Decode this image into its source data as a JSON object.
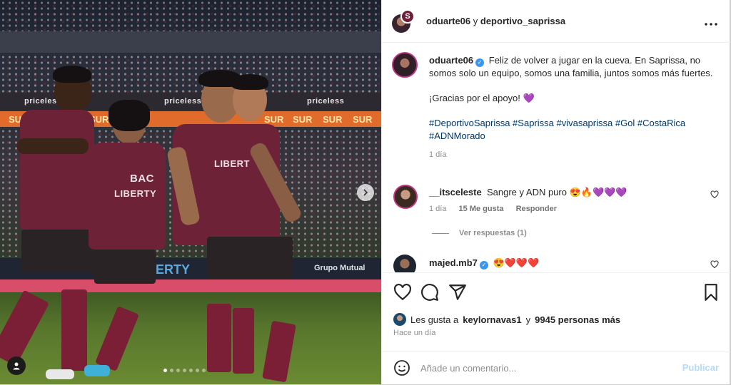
{
  "post": {
    "header": {
      "author": "oduarte06",
      "separator": "y",
      "collaborator": "deportivo_saprissa",
      "badge_letter": "S",
      "more_icon": "more-horizontal-icon"
    },
    "photo": {
      "sponsors": [
        "priceless",
        "priceless",
        "priceless",
        "SUR",
        "SUR",
        "SUR",
        "SUR",
        "SUR",
        "SUR"
      ],
      "board_texts": [
        "BERTY",
        "Grupo Mutual"
      ],
      "jersey_texts": [
        "BAC",
        "LIBERTY",
        "LIBERT"
      ],
      "carousel_count": 7,
      "carousel_active": 0
    },
    "caption": {
      "username": "oduarte06",
      "text_line1": "Feliz de volver a jugar en la cueva. En Saprissa, no somos solo un equipo, somos una familia, juntos somos más fuertes.",
      "text_line2": "¡Gracias por el apoyo!",
      "text_line2_emoji": "💜",
      "hashtags": "#DeportivoSaprissa #Saprissa #vivasaprissa #Gol #CostaRica #ADNMorado",
      "time": "1 día"
    },
    "comments": [
      {
        "username": "__itsceleste",
        "text": "Sangre y ADN puro",
        "emoji": "😍🔥💜💜💜",
        "time": "1 día",
        "likes": "15 Me gusta",
        "reply": "Responder",
        "view_replies": "Ver respuestas (1)"
      },
      {
        "username": "majed.mb7",
        "emoji": "😍❤️❤️❤️"
      }
    ],
    "likes": {
      "prefix": "Les gusta a",
      "user": "keylornavas1",
      "joiner": "y",
      "others": "9945 personas más"
    },
    "date": "Hace un día",
    "add_comment": {
      "placeholder": "Añade un comentario...",
      "publish": "Publicar"
    },
    "colors": {
      "accent_blue": "#0095f6",
      "hashtag": "#00376b",
      "muted": "#8e8e8e",
      "jersey": "#6e2238"
    }
  }
}
